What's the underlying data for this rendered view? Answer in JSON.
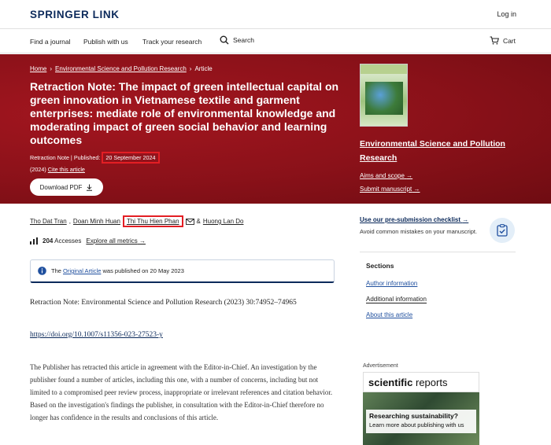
{
  "header": {
    "logo": "SPRINGER LINK",
    "login": "Log in"
  },
  "nav": {
    "items": [
      "Find a journal",
      "Publish with us",
      "Track your research"
    ],
    "search": "Search",
    "cart": "Cart"
  },
  "hero": {
    "breadcrumb": [
      "Home",
      "Environmental Science and Pollution Research",
      "Article"
    ],
    "title": "Retraction Note: The impact of green intellectual capital on green innovation in Vietnamese textile and garment enterprises: mediate role of environmental knowledge and moderating impact of green social behavior and learning outcomes",
    "type": "Retraction Note",
    "published_label": "Published:",
    "published_date": "20 September 2024",
    "year": "(2024)",
    "cite": "Cite this article",
    "download": "Download PDF",
    "journal": "Environmental Science and Pollution Research",
    "aims": "Aims and scope",
    "submit": "Submit manuscript"
  },
  "authors": {
    "list": [
      "Tho Dat Tran",
      "Doan Minh Huan",
      "Thi Thu Hien Phan",
      "Huong Lan Do"
    ],
    "amp": "&"
  },
  "metrics": {
    "accesses": "204",
    "accesses_label": "Accesses",
    "explore": "Explore all metrics"
  },
  "notice": {
    "prefix": "The",
    "link": "Original Article",
    "suffix": "was published on 20 May 2023"
  },
  "body": {
    "retraction_note": "Retraction Note: Environmental Science and Pollution Research (2023) 30:74952–74965",
    "doi": "https://doi.org/10.1007/s11356-023-27523-y",
    "paragraph": "The Publisher has retracted this article in agreement with the Editor-in-Chief. An investigation by the publisher found a number of articles, including this one, with a number of concerns, including but not limited to a compromised peer review process, inappropriate or irrelevant references and citation behavior. Based on the investigation's findings the publisher, in consultation with the Editor-in-Chief therefore no longer has confidence in the results and conclusions of this article."
  },
  "sidebar": {
    "checklist": "Use our pre-submission checklist",
    "checklist_sub": "Avoid common mistakes on your manuscript.",
    "sections_title": "Sections",
    "sections": [
      "Author information",
      "Additional information",
      "About this article"
    ],
    "ad_label": "Advertisement",
    "ad_brand_bold": "scientific",
    "ad_brand_rest": "reports",
    "ad_question": "Researching sustainability?",
    "ad_sub": "Learn more about publishing with us"
  },
  "colors": {
    "hero": "#8a1119",
    "navy": "#0c2a5b",
    "highlight": "#e31e24"
  }
}
